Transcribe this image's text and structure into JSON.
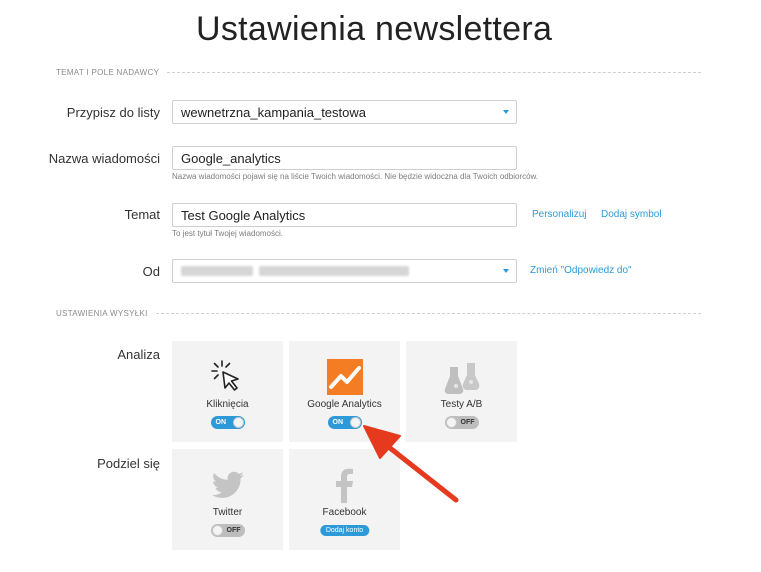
{
  "page": {
    "title": "Ustawienia newslettera"
  },
  "sections": {
    "sender": "TEMAT I POLE NADAWCY",
    "sending": "USTAWIENIA WYSYŁKI"
  },
  "form": {
    "list": {
      "label": "Przypisz do listy",
      "value": "wewnetrzna_kampania_testowa"
    },
    "name": {
      "label": "Nazwa wiadomości",
      "value": "Google_analytics",
      "hint": "Nazwa wiadomości pojawi się na liście Twoich wiadomości. Nie będzie widoczna dla Twoich odbiorców."
    },
    "subject": {
      "label": "Temat",
      "value": "Test Google Analytics",
      "hint": "To jest tytuł Twojej wiadomości.",
      "personalize_link": "Personalizuj",
      "symbol_link": "Dodaj symbol"
    },
    "from": {
      "label": "Od",
      "change_reply_link": "Zmień \"Odpowiedz do\""
    }
  },
  "analysis": {
    "label": "Analiza",
    "tiles": [
      {
        "label": "Kliknięcia",
        "icon": "cursor-click-icon",
        "toggle": "ON"
      },
      {
        "label": "Google Analytics",
        "icon": "google-analytics-icon",
        "toggle": "ON"
      },
      {
        "label": "Testy A/B",
        "icon": "lab-flask-icon",
        "toggle": "OFF"
      }
    ]
  },
  "share": {
    "label": "Podziel się",
    "tiles": [
      {
        "label": "Twitter",
        "icon": "twitter-bird-icon",
        "toggle": "OFF"
      },
      {
        "label": "Facebook",
        "icon": "facebook-f-icon",
        "button": "Dodaj konto"
      }
    ]
  },
  "colors": {
    "accent": "#2c9ad8",
    "tile_bg": "#f3f3f3",
    "ga_orange": "#f47c22",
    "arrow_red": "#e53a1e"
  }
}
